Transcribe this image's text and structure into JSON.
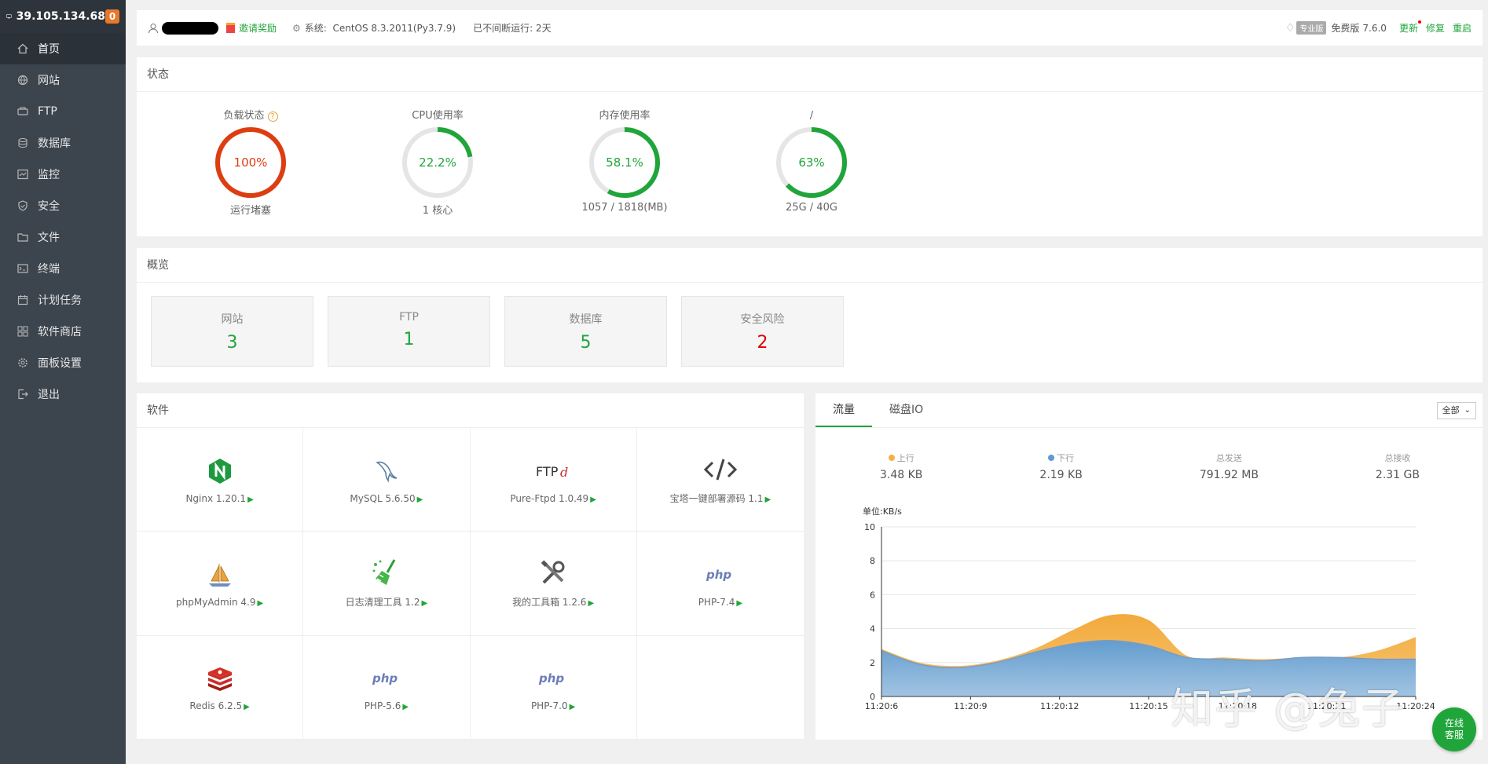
{
  "sidebar": {
    "ip": "39.105.134.68",
    "badge": "0",
    "items": [
      {
        "label": "首页",
        "icon": "home-icon"
      },
      {
        "label": "网站",
        "icon": "globe-icon"
      },
      {
        "label": "FTP",
        "icon": "ftp-icon"
      },
      {
        "label": "数据库",
        "icon": "database-icon"
      },
      {
        "label": "监控",
        "icon": "monitor-icon"
      },
      {
        "label": "安全",
        "icon": "shield-icon"
      },
      {
        "label": "文件",
        "icon": "folder-icon"
      },
      {
        "label": "终端",
        "icon": "terminal-icon"
      },
      {
        "label": "计划任务",
        "icon": "calendar-icon"
      },
      {
        "label": "软件商店",
        "icon": "grid-icon"
      },
      {
        "label": "面板设置",
        "icon": "gear-icon"
      },
      {
        "label": "退出",
        "icon": "logout-icon"
      }
    ]
  },
  "topbar": {
    "invite": "邀请奖励",
    "system_label": "系统:",
    "system_value": "CentOS 8.3.2011(Py3.7.9)",
    "uptime": "已不间断运行: 2天",
    "pro": "专业版",
    "edition": "免费版",
    "version": "7.6.0",
    "update": "更新",
    "repair": "修复",
    "restart": "重启"
  },
  "status": {
    "title": "状态",
    "gauges": [
      {
        "title": "负载状态",
        "value": "100%",
        "percent": 100,
        "sub": "运行堵塞",
        "color": "#dd3d10",
        "help": "?"
      },
      {
        "title": "CPU使用率",
        "value": "22.2%",
        "percent": 22.2,
        "sub": "1 核心",
        "color": "#20a53a"
      },
      {
        "title": "内存使用率",
        "value": "58.1%",
        "percent": 58.1,
        "sub": "1057 / 1818(MB)",
        "color": "#20a53a"
      },
      {
        "title": "/",
        "value": "63%",
        "percent": 63,
        "sub": "25G / 40G",
        "color": "#20a53a"
      }
    ]
  },
  "overview": {
    "title": "概览",
    "boxes": [
      {
        "label": "网站",
        "value": "3"
      },
      {
        "label": "FTP",
        "value": "1"
      },
      {
        "label": "数据库",
        "value": "5"
      },
      {
        "label": "安全风险",
        "value": "2"
      }
    ]
  },
  "software": {
    "title": "软件",
    "items": [
      {
        "name": "Nginx 1.20.1",
        "icon": "nginx-icon"
      },
      {
        "name": "MySQL 5.6.50",
        "icon": "mysql-icon"
      },
      {
        "name": "Pure-Ftpd 1.0.49",
        "icon": "ftpd-icon"
      },
      {
        "name": "宝塔一键部署源码 1.1",
        "icon": "code-icon"
      },
      {
        "name": "phpMyAdmin 4.9",
        "icon": "phpmyadmin-icon"
      },
      {
        "name": "日志清理工具 1.2",
        "icon": "broom-icon"
      },
      {
        "name": "我的工具箱 1.2.6",
        "icon": "tools-icon"
      },
      {
        "name": "PHP-7.4",
        "icon": "php-icon"
      },
      {
        "name": "Redis 6.2.5",
        "icon": "redis-icon"
      },
      {
        "name": "PHP-5.6",
        "icon": "php-icon"
      },
      {
        "name": "PHP-7.0",
        "icon": "php-icon"
      }
    ]
  },
  "traffic": {
    "tabs": [
      "流量",
      "磁盘IO"
    ],
    "select": "全部",
    "stats": [
      {
        "label": "上行",
        "value": "3.48 KB",
        "dot": "#f5b041"
      },
      {
        "label": "下行",
        "value": "2.19 KB",
        "dot": "#5b9bd5"
      },
      {
        "label": "总发送",
        "value": "791.92 MB"
      },
      {
        "label": "总接收",
        "value": "2.31 GB"
      }
    ]
  },
  "chart_data": {
    "type": "area",
    "ylabel": "单位:KB/s",
    "ylim": [
      0,
      10
    ],
    "yticks": [
      0,
      2,
      4,
      6,
      8,
      10
    ],
    "xticks": [
      "11:20:6",
      "11:20:9",
      "11:20:12",
      "11:20:15",
      "11:20:18",
      "11:20:21",
      "11:20:24"
    ],
    "x": [
      "11:20:6",
      "11:20:7.5",
      "11:20:9",
      "11:20:10.5",
      "11:20:12",
      "11:20:13.5",
      "11:20:15",
      "11:20:16.5",
      "11:20:18",
      "11:20:19.5",
      "11:20:21",
      "11:20:22.5",
      "11:20:24",
      "11:20:25.5",
      "11:20:27"
    ],
    "series": [
      {
        "name": "上行",
        "color": "#f5b041",
        "values": [
          2.8,
          2.0,
          1.8,
          2.1,
          2.8,
          3.9,
          4.8,
          4.5,
          2.4,
          2.3,
          2.2,
          2.3,
          2.3,
          2.7,
          3.5
        ]
      },
      {
        "name": "下行",
        "color": "#5b9bd5",
        "values": [
          2.7,
          1.9,
          1.7,
          2.0,
          2.6,
          3.1,
          3.3,
          3.0,
          2.3,
          2.2,
          2.1,
          2.3,
          2.3,
          2.2,
          2.2
        ]
      }
    ]
  },
  "watermark": "知乎 @兔子",
  "service": {
    "line1": "在线",
    "line2": "客服"
  }
}
